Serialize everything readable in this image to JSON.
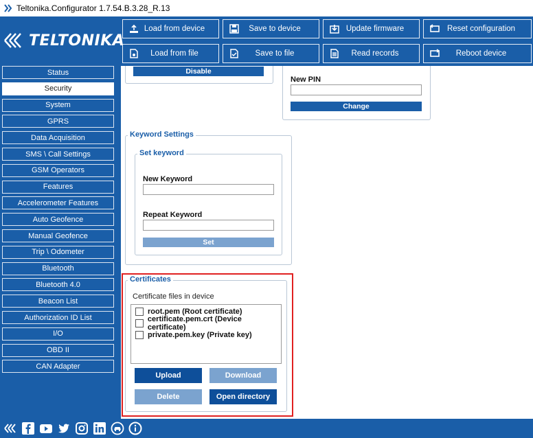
{
  "window": {
    "title": "Teltonika.Configurator 1.7.54.B.3.28_R.13"
  },
  "logo": {
    "text": "TELTONIKA"
  },
  "toolbar": {
    "load_device": "Load from device",
    "save_device": "Save to device",
    "update_fw": "Update firmware",
    "reset_cfg": "Reset configuration",
    "load_file": "Load from file",
    "save_file": "Save to file",
    "read_records": "Read records",
    "reboot": "Reboot device"
  },
  "sidebar": {
    "items": [
      {
        "label": "Status"
      },
      {
        "label": "Security"
      },
      {
        "label": "System"
      },
      {
        "label": "GPRS"
      },
      {
        "label": "Data Acquisition"
      },
      {
        "label": "SMS \\ Call Settings"
      },
      {
        "label": "GSM Operators"
      },
      {
        "label": "Features"
      },
      {
        "label": "Accelerometer Features"
      },
      {
        "label": "Auto Geofence"
      },
      {
        "label": "Manual Geofence"
      },
      {
        "label": "Trip \\ Odometer"
      },
      {
        "label": "Bluetooth"
      },
      {
        "label": "Bluetooth 4.0"
      },
      {
        "label": "Beacon List"
      },
      {
        "label": "Authorization ID List"
      },
      {
        "label": "I/O"
      },
      {
        "label": "OBD II"
      },
      {
        "label": "CAN Adapter"
      }
    ],
    "active_index": 1
  },
  "pin": {
    "disable_label": "Disable",
    "new_pin_label": "New PIN",
    "new_pin_value": "",
    "change_label": "Change"
  },
  "keyword": {
    "group_title": "Keyword Settings",
    "sub_title": "Set keyword",
    "new_label": "New Keyword",
    "new_value": "",
    "repeat_label": "Repeat Keyword",
    "repeat_value": "",
    "set_label": "Set"
  },
  "certificates": {
    "title": "Certificates",
    "list_label": "Certificate files in device",
    "files": [
      {
        "name": "root.pem (Root certificate)",
        "checked": false
      },
      {
        "name": "certificate.pem.crt (Device certificate)",
        "checked": false
      },
      {
        "name": "private.pem.key (Private key)",
        "checked": false
      }
    ],
    "upload_label": "Upload",
    "download_label": "Download",
    "delete_label": "Delete",
    "open_dir_label": "Open directory"
  },
  "colors": {
    "brand": "#1a5ea8",
    "highlight": "#e02020",
    "disabled": "#7ba3cf"
  },
  "footer": {
    "icons": [
      "teltonika-icon",
      "facebook-icon",
      "youtube-icon",
      "twitter-icon",
      "instagram-icon",
      "linkedin-icon",
      "car-icon",
      "info-icon"
    ]
  }
}
